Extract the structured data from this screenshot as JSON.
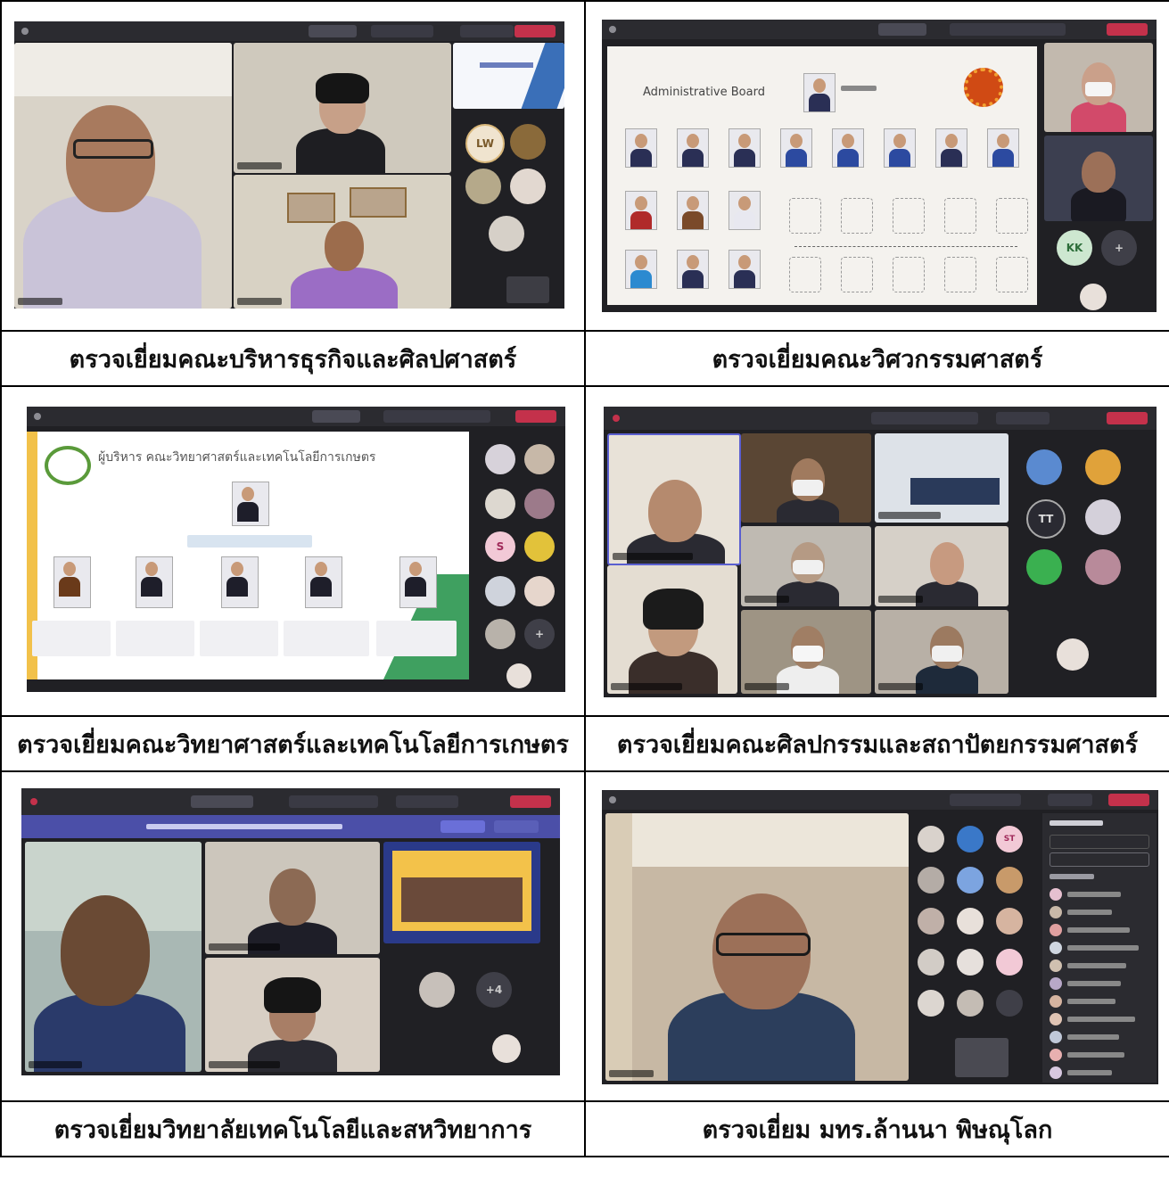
{
  "captions": [
    "ตรวจเยี่ยมคณะบริหารธุรกิจและศิลปศาสตร์",
    "ตรวจเยี่ยมคณะวิศวกรรมศาสตร์",
    "ตรวจเยี่ยมคณะวิทยาศาสตร์และเทคโนโลยีการเกษตร",
    "ตรวจเยี่ยมคณะศิลปกรรมและสถาปัตยกรรมศาสตร์",
    "ตรวจเยี่ยมวิทยาลัยเทคโนโลยีและสหวิทยาการ",
    "ตรวจเยี่ยม มทร.ล้านนา พิษณุโลก"
  ],
  "screens": {
    "s1": {
      "avatar_initials": "LW"
    },
    "s2": {
      "slide_title": "Administrative Board",
      "avatar_initials": "KK"
    },
    "s3": {
      "slide_title": "ผู้บริหาร คณะวิทยาศาสตร์และเทคโนโลยีการเกษตร",
      "avatar_initials": "S"
    },
    "s4": {
      "avatar_initials": "TT"
    },
    "s5": {
      "avatar_count": "+4"
    },
    "s6": {
      "avatar_initials": "ST"
    }
  },
  "colors": {
    "teams_dark": "#202024",
    "leave_red": "#c4314b",
    "accent_purple": "#4b4fa8"
  }
}
